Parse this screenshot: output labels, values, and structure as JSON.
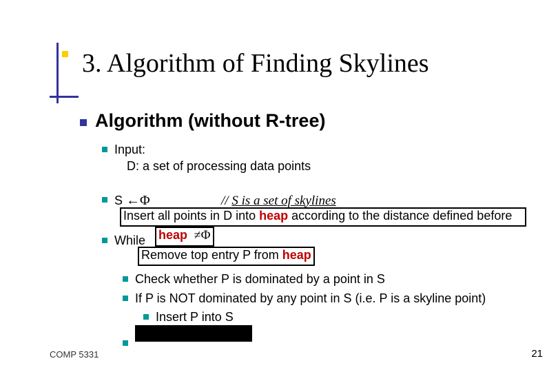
{
  "title": "3. Algorithm of Finding Skylines",
  "heading": "Algorithm (without R-tree)",
  "input": {
    "label": "Input:",
    "line1": "D: a set of processing data points"
  },
  "assign": {
    "lhs": "S",
    "arrow": "←",
    "rhs": "Φ",
    "comment_prefix": "// ",
    "comment_body": "S is a set of skylines"
  },
  "box_insert_pre": "Insert all points in D into ",
  "box_insert_heap": "heap",
  "box_insert_post": " according to the distance defined before",
  "while": {
    "word": "While",
    "heap": "heap",
    "neq": "≠",
    "phi": "Φ"
  },
  "box_remove_pre": "Remove top entry P from ",
  "box_remove_heap": "heap",
  "step_check": "Check whether P is dominated by a point in S",
  "step_if": "If P is NOT dominated by any point in S (i.e. P is a skyline point)",
  "step_insert": "Insert P into S",
  "footer_left": "COMP 5331",
  "footer_right": "21"
}
